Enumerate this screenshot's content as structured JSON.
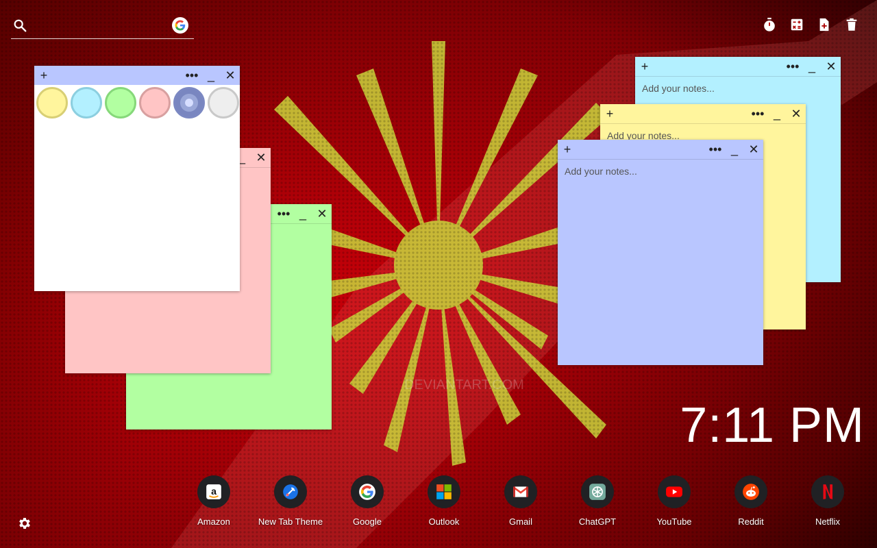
{
  "search": {
    "placeholder": ""
  },
  "tools": [
    "timer-icon",
    "calculator-icon",
    "new-note-icon",
    "trash-icon"
  ],
  "notes": {
    "note_placeholder": "Add your notes...",
    "colors": {
      "yellow": "#fff59d",
      "cyan": "#b3f0ff",
      "green": "#b2ffa1",
      "pink": "#ffc5c5",
      "blue": "#b9c6ff",
      "white": "#ffffff"
    },
    "palette": [
      "yellow",
      "cyan",
      "green",
      "pink",
      "blue",
      "gray"
    ]
  },
  "clock": {
    "time": "7:11 PM"
  },
  "shortcuts": [
    {
      "label": "Amazon",
      "icon": "amazon-icon"
    },
    {
      "label": "New Tab Theme",
      "icon": "new-tab-theme-icon"
    },
    {
      "label": "Google",
      "icon": "google-icon"
    },
    {
      "label": "Outlook",
      "icon": "outlook-icon"
    },
    {
      "label": "Gmail",
      "icon": "gmail-icon"
    },
    {
      "label": "ChatGPT",
      "icon": "chatgpt-icon"
    },
    {
      "label": "YouTube",
      "icon": "youtube-icon"
    },
    {
      "label": "Reddit",
      "icon": "reddit-icon"
    },
    {
      "label": "Netflix",
      "icon": "netflix-icon"
    }
  ],
  "watermark": "DEVIANTART.COM"
}
